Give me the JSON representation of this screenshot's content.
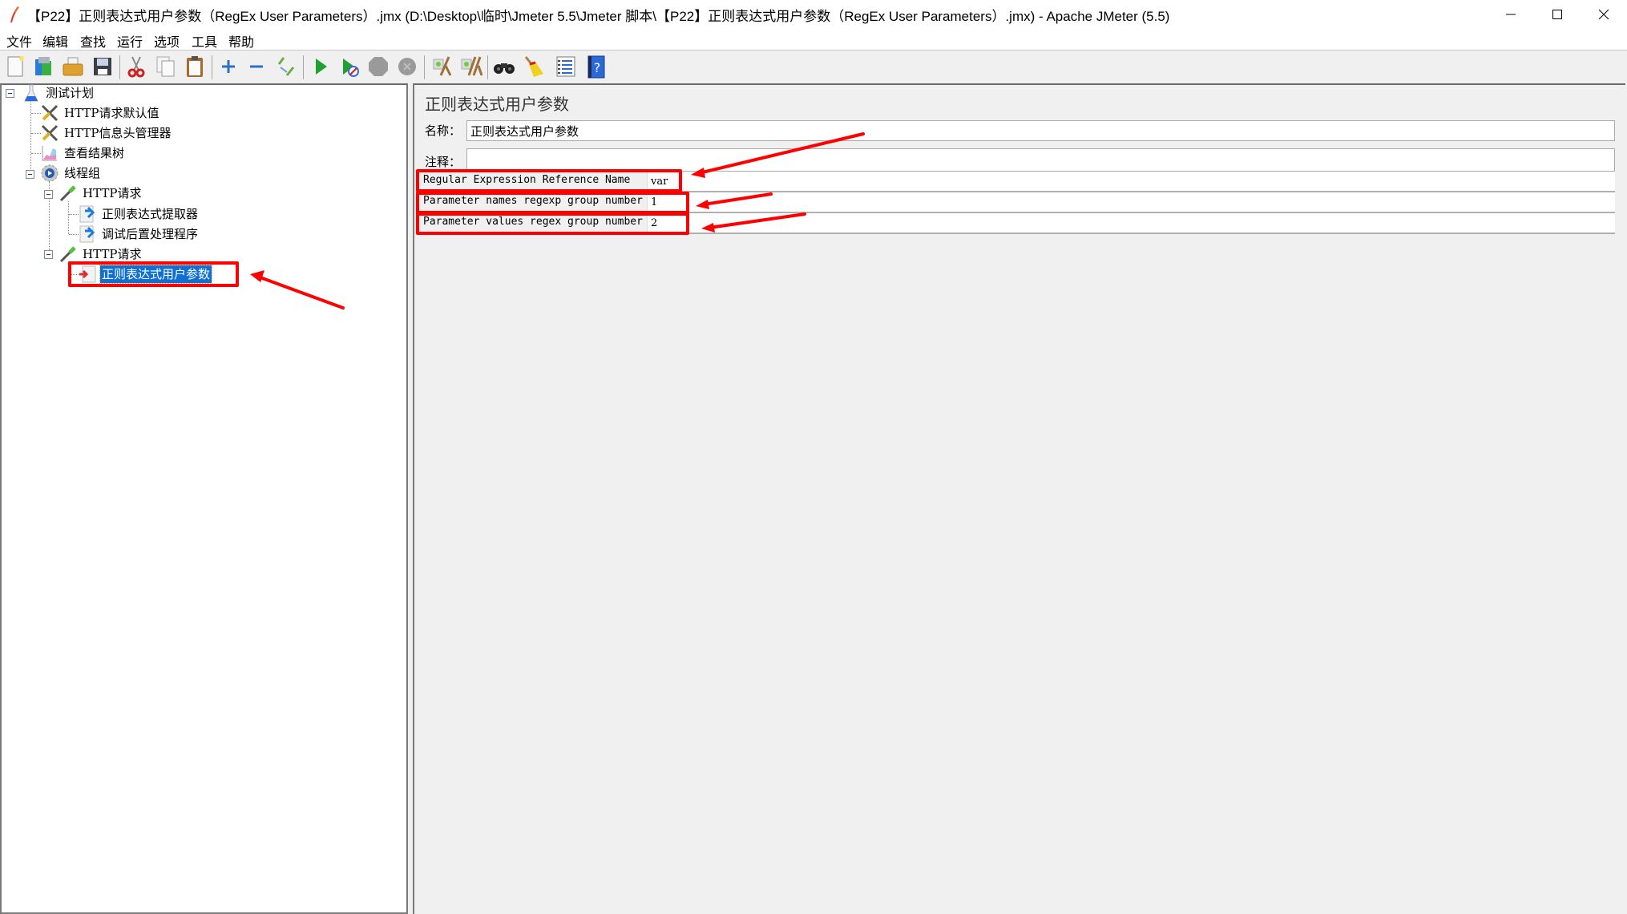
{
  "window": {
    "title": "【P22】正则表达式用户参数（RegEx User Parameters）.jmx (D:\\Desktop\\临时\\Jmeter 5.5\\Jmeter 脚本\\【P22】正则表达式用户参数（RegEx User Parameters）.jmx) - Apache JMeter (5.5)",
    "controls": {
      "minimize": "minimize-icon",
      "maximize": "maximize-icon",
      "close": "close-icon"
    }
  },
  "menu": {
    "items": [
      "文件",
      "编辑",
      "查找",
      "运行",
      "选项",
      "工具",
      "帮助"
    ]
  },
  "toolbar": {
    "buttons": [
      {
        "icon": "new-icon"
      },
      {
        "icon": "templates-icon"
      },
      {
        "icon": "open-icon"
      },
      {
        "icon": "save-icon"
      },
      {
        "icon": "cut-icon"
      },
      {
        "icon": "copy-icon"
      },
      {
        "icon": "paste-icon"
      },
      {
        "icon": "expand-all-icon"
      },
      {
        "icon": "collapse-all-icon"
      },
      {
        "icon": "toggle-icon"
      },
      {
        "icon": "start-icon"
      },
      {
        "icon": "start-no-pauses-icon"
      },
      {
        "icon": "stop-icon"
      },
      {
        "icon": "shutdown-icon"
      },
      {
        "icon": "clear-icon"
      },
      {
        "icon": "clear-all-icon"
      },
      {
        "icon": "search-icon"
      },
      {
        "icon": "reset-search-icon"
      },
      {
        "icon": "function-helper-icon"
      },
      {
        "icon": "help-icon"
      }
    ]
  },
  "tree": {
    "nodes": [
      {
        "label": "测试计划",
        "icon": "test-plan-icon",
        "level": 0,
        "expanded": true
      },
      {
        "label": "HTTP请求默认值",
        "icon": "config-element-icon",
        "level": 1
      },
      {
        "label": "HTTP信息头管理器",
        "icon": "config-element-icon",
        "level": 1
      },
      {
        "label": "查看结果树",
        "icon": "listener-icon",
        "level": 1
      },
      {
        "label": "线程组",
        "icon": "thread-group-icon",
        "level": 1,
        "expanded": true
      },
      {
        "label": "HTTP请求",
        "icon": "sampler-icon",
        "level": 2,
        "expanded": true
      },
      {
        "label": "正则表达式提取器",
        "icon": "post-processor-icon",
        "level": 3
      },
      {
        "label": "调试后置处理程序",
        "icon": "post-processor-icon",
        "level": 3
      },
      {
        "label": "HTTP请求",
        "icon": "sampler-icon",
        "level": 2,
        "expanded": true
      },
      {
        "label": "正则表达式用户参数",
        "icon": "pre-processor-icon",
        "level": 3,
        "selected": true
      }
    ]
  },
  "main": {
    "title": "正则表达式用户参数",
    "name_label": "名称：",
    "name_value": "正则表达式用户参数",
    "comment_label": "注释：",
    "comment_value": "",
    "params": [
      {
        "label": "Regular Expression Reference Name",
        "value": "var"
      },
      {
        "label": "Parameter names regexp group number",
        "value": "1"
      },
      {
        "label": "Parameter values regex group number",
        "value": "2"
      }
    ]
  },
  "colors": {
    "selection": "#0f6fd3",
    "annotation": "#ff0000",
    "panel_bg": "#f0f0f0"
  }
}
